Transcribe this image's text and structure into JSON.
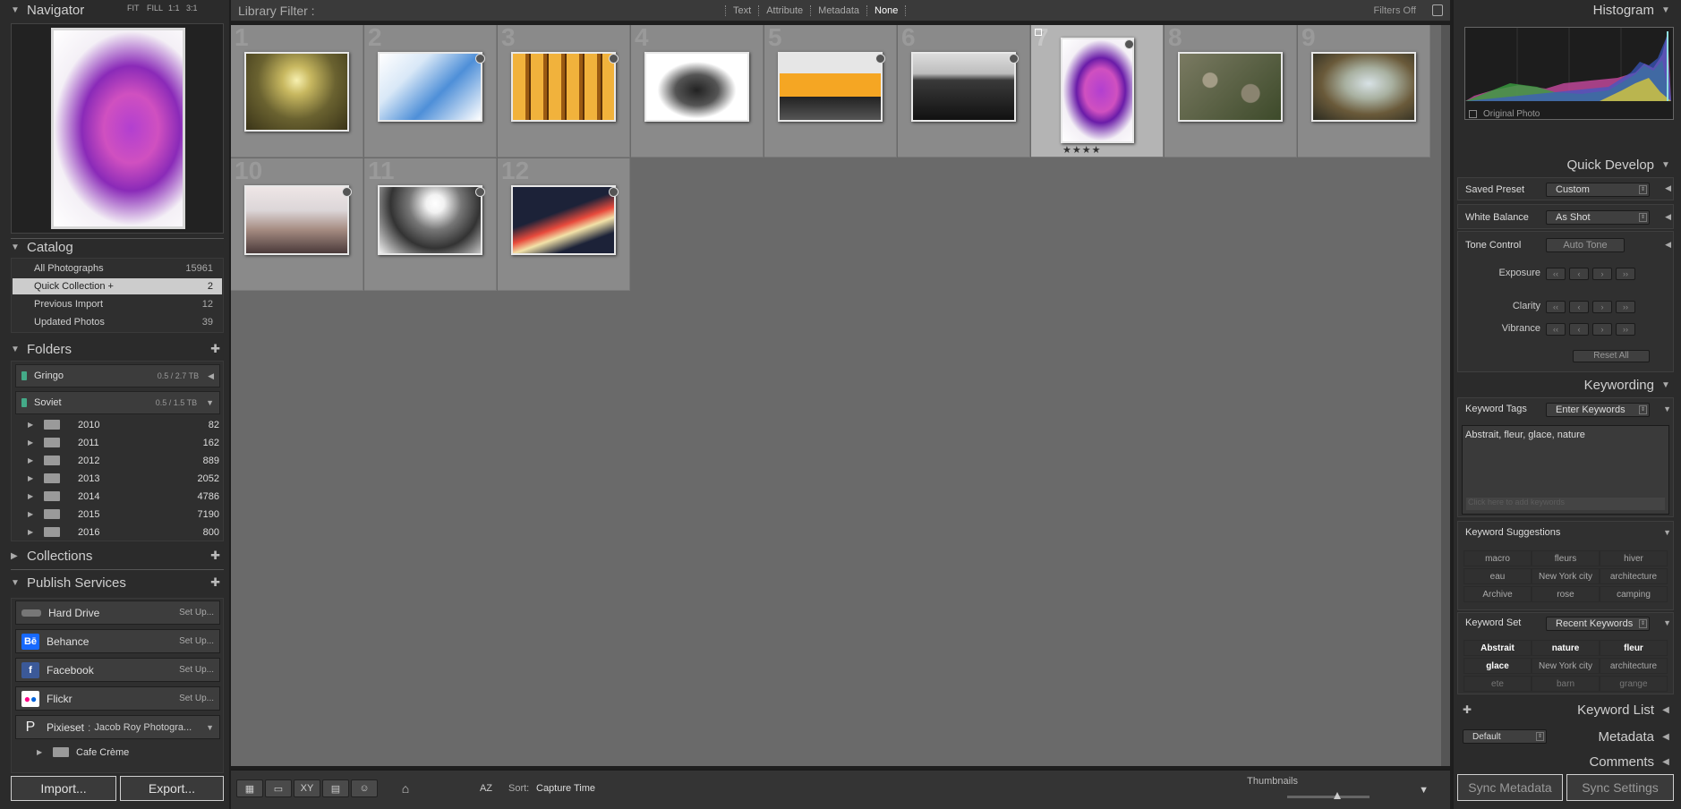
{
  "left_panel": {
    "navigator": {
      "title": "Navigator",
      "zoom_options": [
        "FIT",
        "FILL",
        "1:1",
        "3:1"
      ]
    },
    "catalog": {
      "title": "Catalog",
      "items": [
        {
          "label": "All Photographs",
          "count": "15961"
        },
        {
          "label": "Quick Collection +",
          "count": "2"
        },
        {
          "label": "Previous Import",
          "count": "12"
        },
        {
          "label": "Updated Photos",
          "count": "39"
        }
      ]
    },
    "folders": {
      "title": "Folders",
      "volumes": [
        {
          "name": "Gringo",
          "capacity": "0.5 / 2.7 TB"
        },
        {
          "name": "Soviet",
          "capacity": "0.5 / 1.5 TB"
        }
      ],
      "items": [
        {
          "label": "2010",
          "count": "82"
        },
        {
          "label": "2011",
          "count": "162"
        },
        {
          "label": "2012",
          "count": "889"
        },
        {
          "label": "2013",
          "count": "2052"
        },
        {
          "label": "2014",
          "count": "4786"
        },
        {
          "label": "2015",
          "count": "7190"
        },
        {
          "label": "2016",
          "count": "800"
        }
      ]
    },
    "collections": {
      "title": "Collections"
    },
    "publish": {
      "title": "Publish Services",
      "services": [
        {
          "label": "Hard Drive",
          "action": "Set Up..."
        },
        {
          "label": "Behance",
          "action": "Set Up..."
        },
        {
          "label": "Facebook",
          "action": "Set Up..."
        },
        {
          "label": "Flickr",
          "action": "Set Up..."
        },
        {
          "label": "Pixieset",
          "account": "Jacob Roy Photogra..."
        }
      ],
      "sub_item": "Cafe Crème"
    },
    "import_label": "Import...",
    "export_label": "Export..."
  },
  "filter_bar": {
    "label": "Library Filter :",
    "tabs": [
      "Text",
      "Attribute",
      "Metadata",
      "None"
    ],
    "active": "None",
    "filters_off": "Filters Off"
  },
  "grid": {
    "cells": [
      {
        "num": "1",
        "colors": [
          "#d8cf7a",
          "#7d7a30",
          "#3e3a18"
        ]
      },
      {
        "num": "2",
        "colors": [
          "#d9e8f7",
          "#4e8fd8",
          "#ffffff"
        ]
      },
      {
        "num": "3",
        "colors": [
          "#f1b23c",
          "#9a5a12",
          "#5a3008"
        ]
      },
      {
        "num": "4",
        "colors": [
          "#ffffff",
          "#222222",
          "#888888"
        ]
      },
      {
        "num": "5",
        "colors": [
          "#e6e6e6",
          "#f5a623",
          "#222222"
        ]
      },
      {
        "num": "6",
        "colors": [
          "#dcdcdc",
          "#3a3a3a",
          "#111111"
        ]
      },
      {
        "num": "7",
        "colors": [
          "#ffffff",
          "#b23fd0",
          "#6a1ca8"
        ],
        "selected": true,
        "rating": "★★★★"
      },
      {
        "num": "8",
        "colors": [
          "#7a7a62",
          "#3d4a2a",
          "#a39c86"
        ]
      },
      {
        "num": "9",
        "colors": [
          "#d8e2e6",
          "#6a5a3a",
          "#2a2a20"
        ]
      },
      {
        "num": "10",
        "colors": [
          "#dcd6d8",
          "#a48a80",
          "#4a3a3a"
        ]
      },
      {
        "num": "11",
        "colors": [
          "#f2f2f2",
          "#333333",
          "#777777"
        ]
      },
      {
        "num": "12",
        "colors": [
          "#1c2238",
          "#e84a3c",
          "#f2e2a8"
        ]
      }
    ]
  },
  "toolbar": {
    "sort_label": "Sort:",
    "sort_value": "Capture Time",
    "thumbnails_label": "Thumbnails",
    "xy": "XY",
    "az": "AZ"
  },
  "right_panel": {
    "histogram": {
      "title": "Histogram",
      "original_photo": "Original Photo"
    },
    "quick_develop": {
      "title": "Quick Develop",
      "saved_preset_label": "Saved Preset",
      "saved_preset_value": "Custom",
      "white_balance_label": "White Balance",
      "white_balance_value": "As Shot",
      "tone_control_label": "Tone Control",
      "auto_tone": "Auto Tone",
      "exposure": "Exposure",
      "clarity": "Clarity",
      "vibrance": "Vibrance",
      "reset_all": "Reset All"
    },
    "keywording": {
      "title": "Keywording",
      "tags_label": "Keyword Tags",
      "tags_mode": "Enter Keywords",
      "keywords": "Abstrait, fleur, glace, nature",
      "add_hint": "Click here to add keywords",
      "suggestions_label": "Keyword Suggestions",
      "suggestions": [
        "macro",
        "fleurs",
        "hiver",
        "eau",
        "New York city",
        "architecture",
        "Archive",
        "rose",
        "camping"
      ],
      "set_label": "Keyword Set",
      "set_value": "Recent Keywords",
      "set_items": [
        "Abstrait",
        "nature",
        "fleur",
        "glace",
        "New York city",
        "architecture",
        "ete",
        "barn",
        "grange"
      ]
    },
    "keyword_list": "Keyword List",
    "metadata": {
      "title": "Metadata",
      "preset": "Default"
    },
    "comments": "Comments",
    "sync_metadata": "Sync Metadata",
    "sync_settings": "Sync Settings"
  }
}
